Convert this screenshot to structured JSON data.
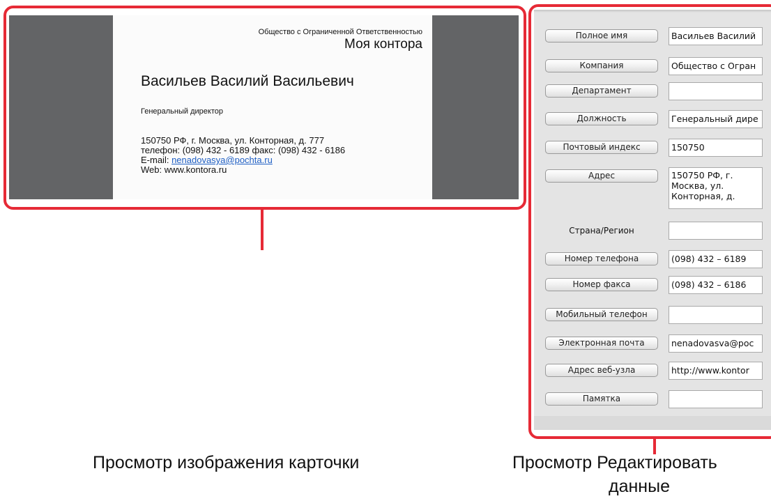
{
  "card": {
    "company": "Общество с Ограниченной Ответственностью",
    "office": "Моя  контора",
    "name": "Васильев Василий Васильевич",
    "position": "Генеральный директор",
    "address": "150750 РФ, г. Москва, ул. Конторная, д. 777",
    "phone": "телефон: (098) 432 - 6189 факс: (098) 432 - 6186",
    "email_label": "E-mail: ",
    "email": "nenadovasya@pochta.ru",
    "web": "Web: www.kontora.ru"
  },
  "fields": [
    {
      "label": "Полное имя",
      "value": "Васильев Василий"
    },
    {
      "label": "Компания",
      "value": "Общество с Огран"
    },
    {
      "label": "Департамент",
      "value": ""
    },
    {
      "label": "Должность",
      "value": "Генеральный дире"
    },
    {
      "label": "Почтовый индекс",
      "value": "150750"
    },
    {
      "label": "Адрес",
      "value": "150750 РФ, г.\nМосква, ул.\nКонторная, д."
    },
    {
      "label": "Страна/Регион",
      "value": ""
    },
    {
      "label": "Номер телефона",
      "value": "(098) 432 – 6189"
    },
    {
      "label": "Номер факса",
      "value": "(098) 432 – 6186"
    },
    {
      "label": "Мобильный телефон",
      "value": ""
    },
    {
      "label": "Электронная почта",
      "value": "nenadovasva@poc"
    },
    {
      "label": "Адрес веб-узла",
      "value": "http://www.kontor"
    },
    {
      "label": "Памятка",
      "value": ""
    }
  ],
  "captions": {
    "card_view": "Просмотр изображения карточки",
    "edit_view_line1": "Просмотр Редактировать",
    "edit_view_line2": "данные"
  },
  "colors": {
    "callout": "#e62a36",
    "image_background": "#636466",
    "panel_background": "#e4e4e4"
  }
}
